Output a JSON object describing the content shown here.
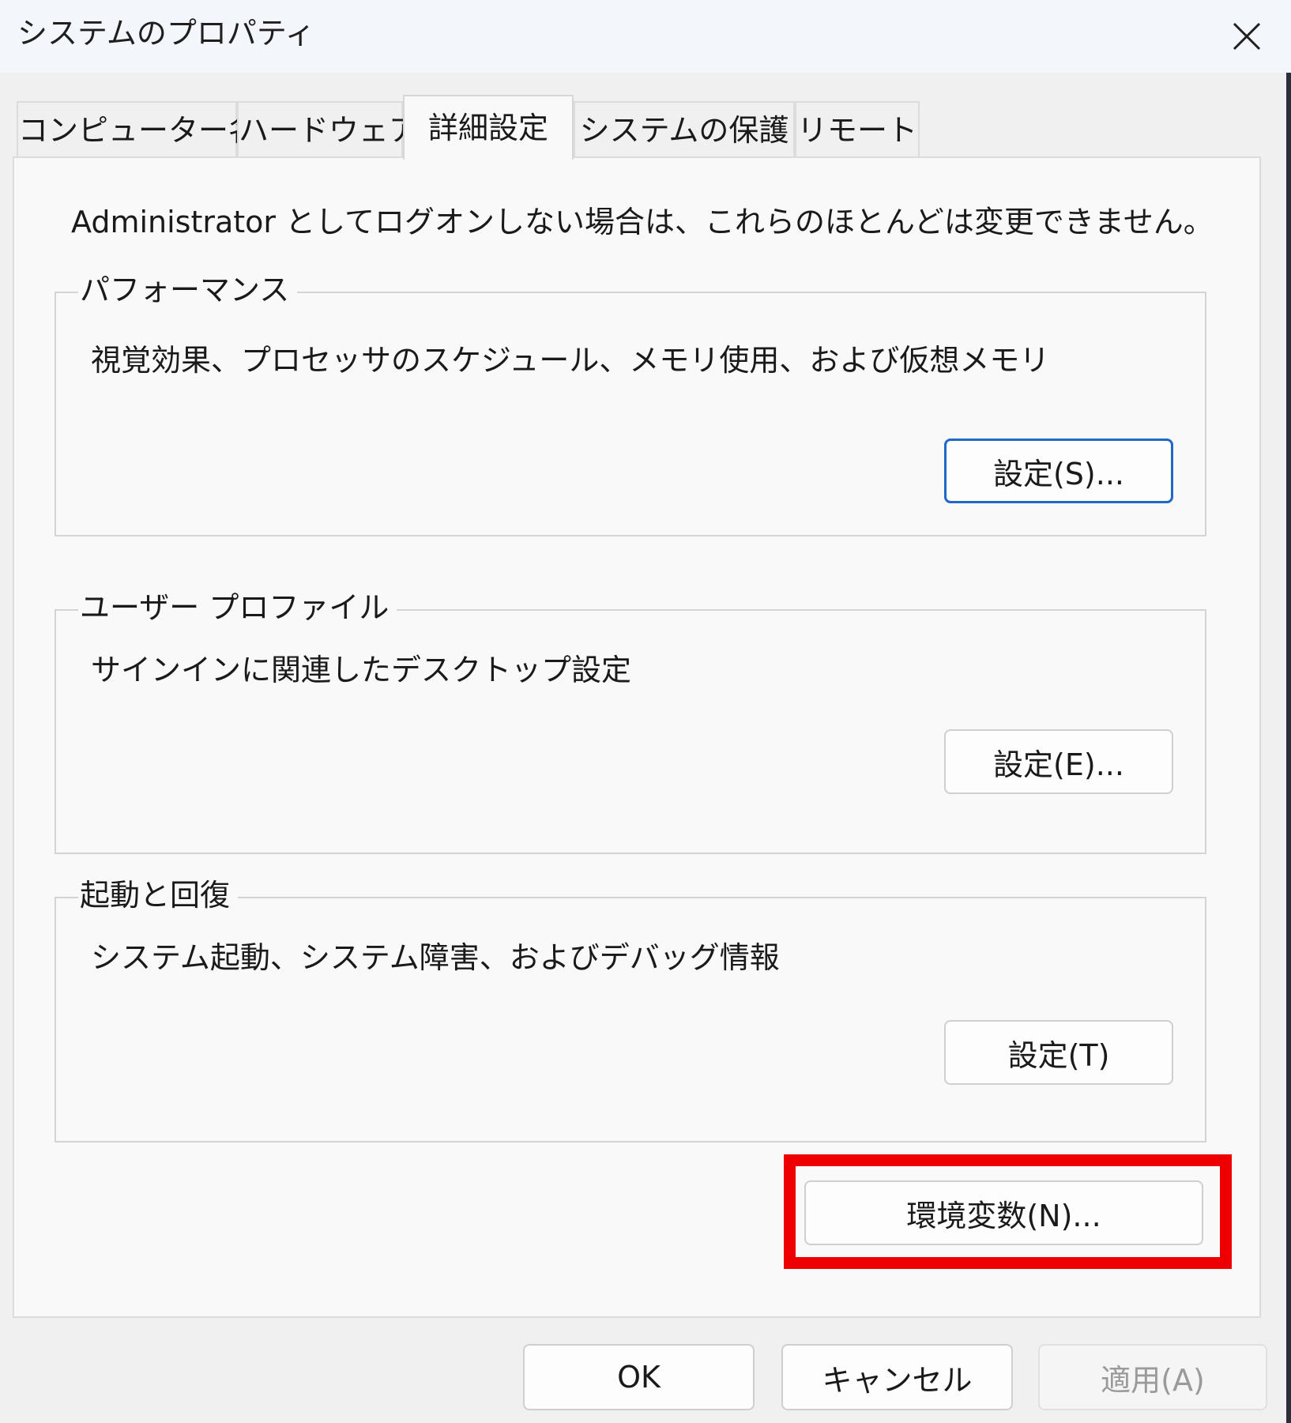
{
  "window": {
    "title": "システムのプロパティ"
  },
  "tabs": [
    {
      "label": "コンピューター名",
      "active": false
    },
    {
      "label": "ハードウェア",
      "active": false
    },
    {
      "label": "詳細設定",
      "active": true
    },
    {
      "label": "システムの保護",
      "active": false
    },
    {
      "label": "リモート",
      "active": false
    }
  ],
  "advanced": {
    "admin_note": "Administrator としてログオンしない場合は、これらのほとんどは変更できません。",
    "performance": {
      "title": "パフォーマンス",
      "description": "視覚効果、プロセッサのスケジュール、メモリ使用、および仮想メモリ",
      "button": "設定(S)..."
    },
    "user_profiles": {
      "title": "ユーザー プロファイル",
      "description": "サインインに関連したデスクトップ設定",
      "button": "設定(E)..."
    },
    "startup_recovery": {
      "title": "起動と回復",
      "description": "システム起動、システム障害、およびデバッグ情報",
      "button": "設定(T)"
    },
    "env_button": "環境変数(N)..."
  },
  "footer": {
    "ok": "OK",
    "cancel": "キャンセル",
    "apply": "適用(A)"
  },
  "colors": {
    "highlight": "#ee0000",
    "focus_border": "#2068c8"
  },
  "icons": {
    "close": "close-icon"
  }
}
